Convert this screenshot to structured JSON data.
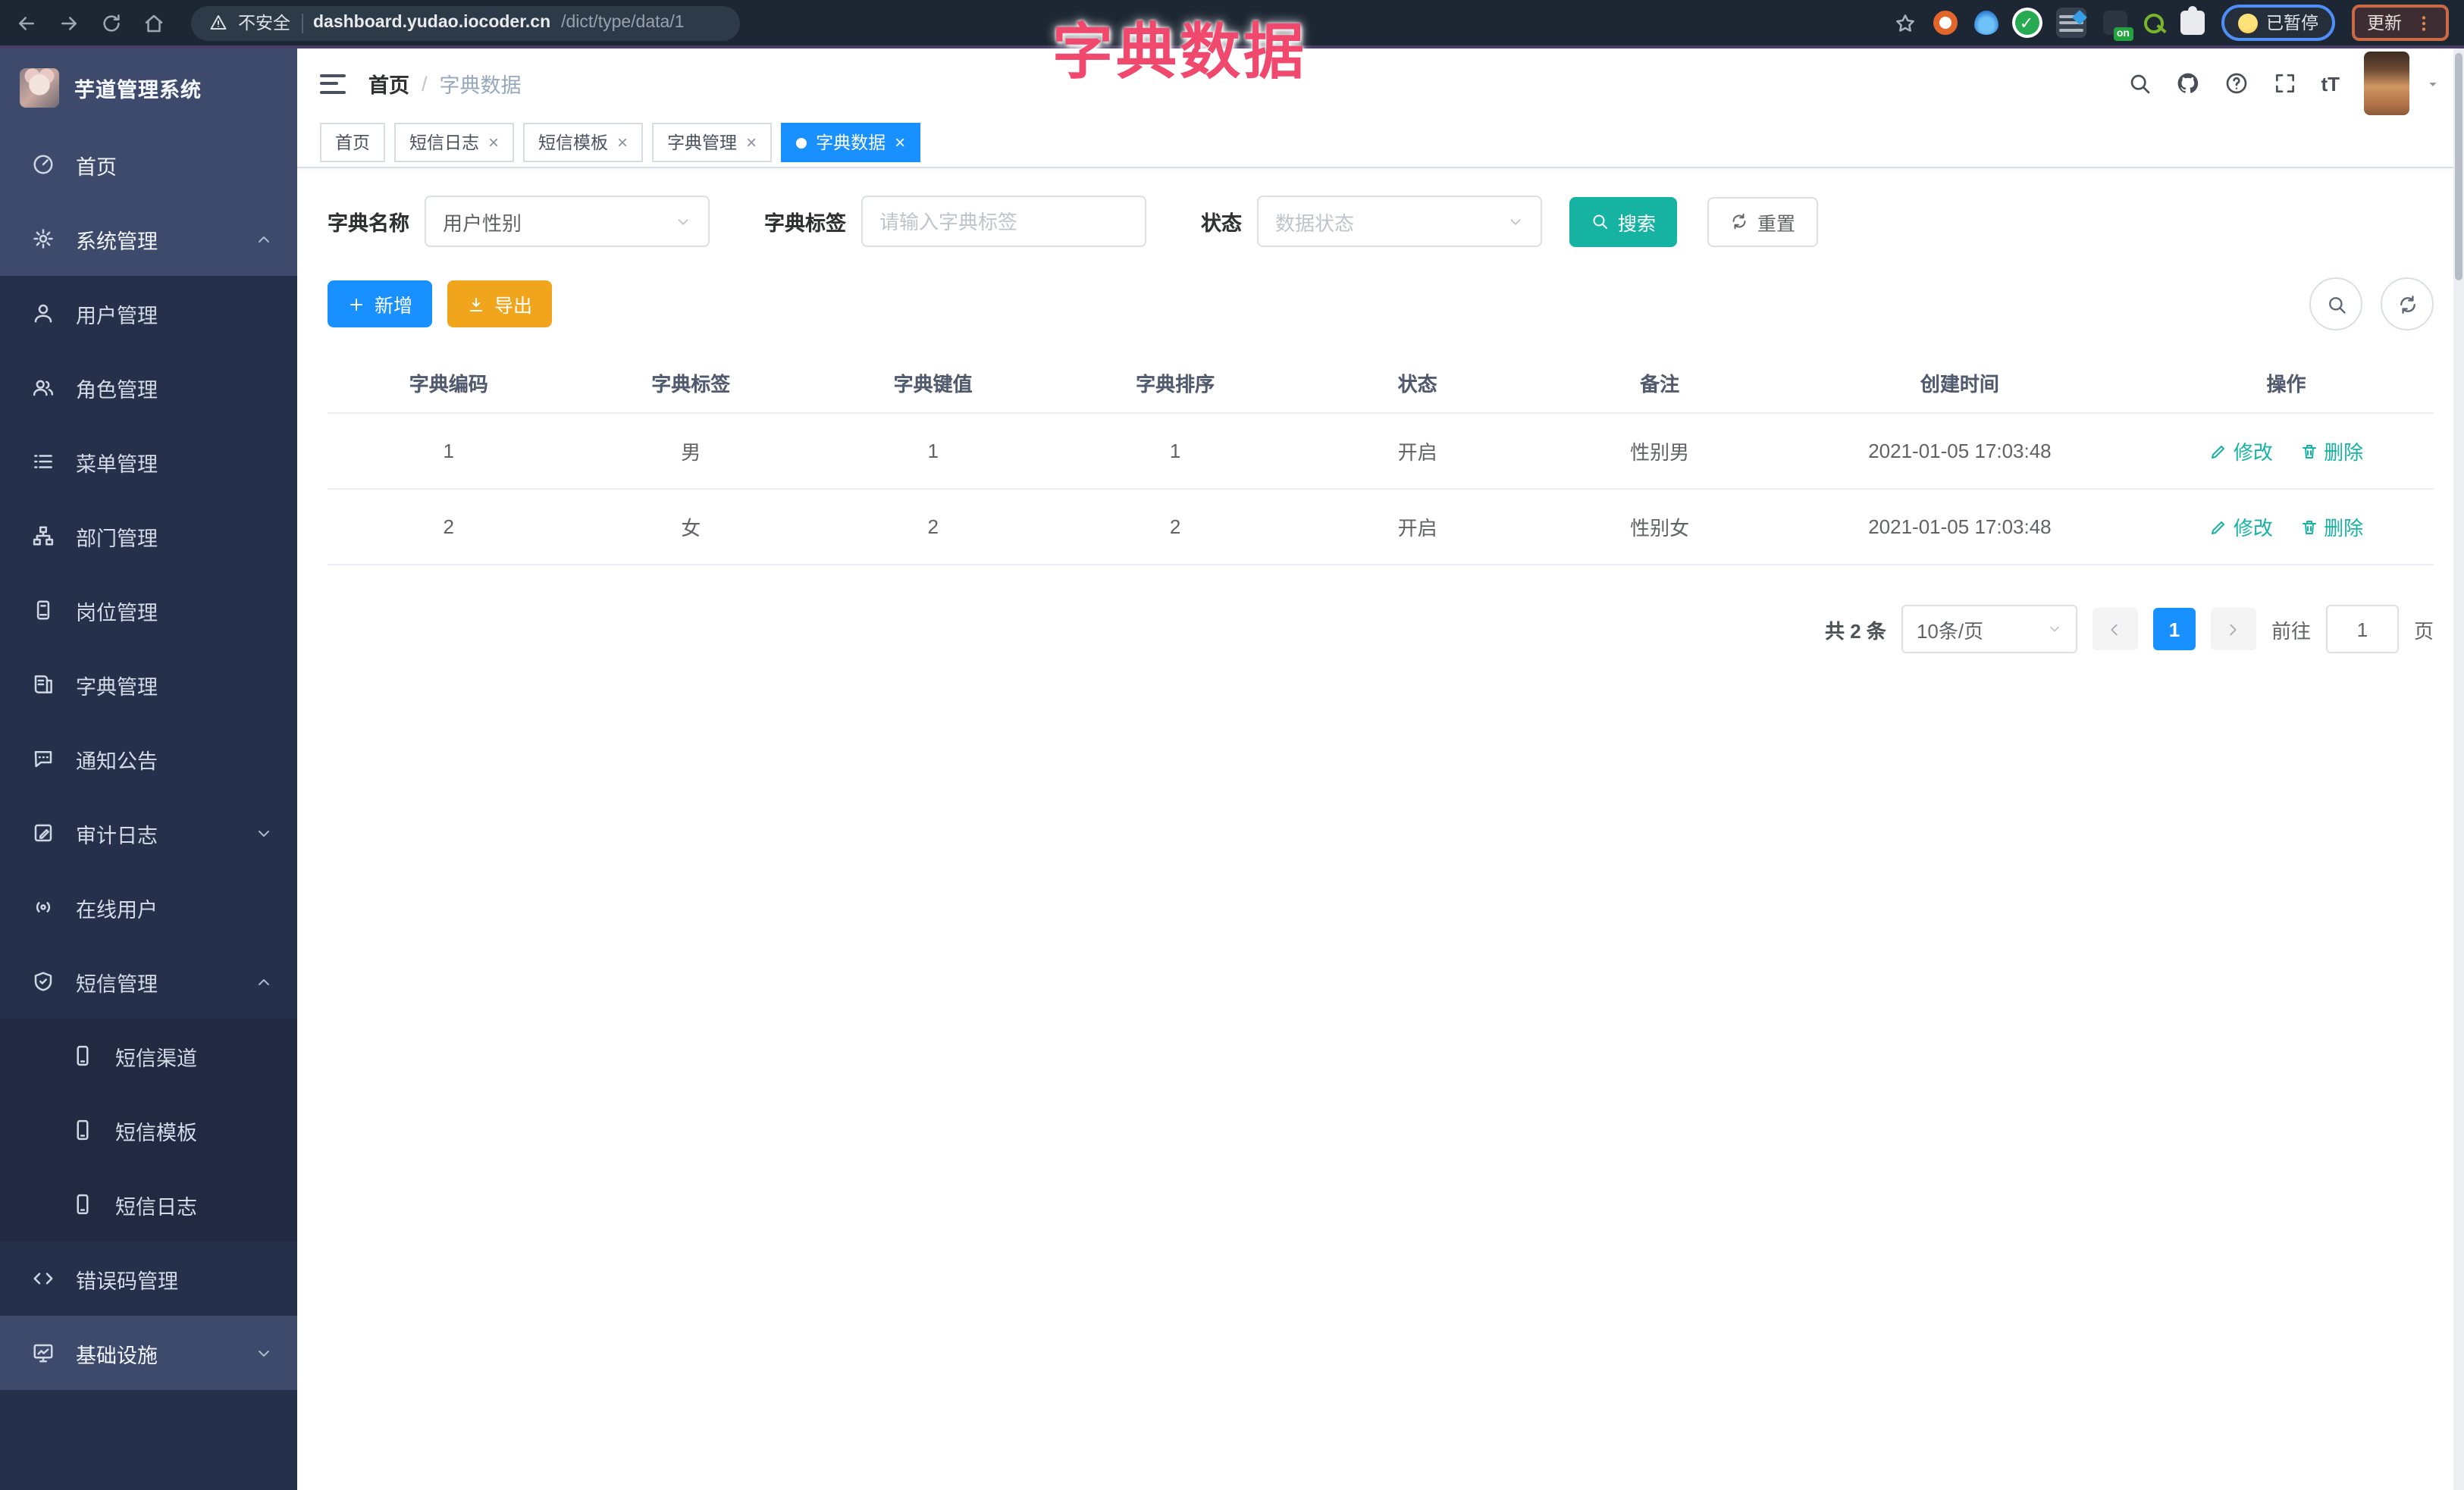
{
  "browser": {
    "security_label": "不安全",
    "url_domain": "dashboard.yudao.iocoder.cn",
    "url_path": "/dict/type/data/1",
    "paused_label": "已暂停",
    "update_label": "更新",
    "on_badge": "on"
  },
  "annotation": {
    "title": "字典数据",
    "color": "#f1486d"
  },
  "sidebar": {
    "logo_title": "芋道管理系统",
    "items": [
      {
        "label": "首页"
      },
      {
        "label": "系统管理"
      },
      {
        "label": "用户管理"
      },
      {
        "label": "角色管理"
      },
      {
        "label": "菜单管理"
      },
      {
        "label": "部门管理"
      },
      {
        "label": "岗位管理"
      },
      {
        "label": "字典管理"
      },
      {
        "label": "通知公告"
      },
      {
        "label": "审计日志"
      },
      {
        "label": "在线用户"
      },
      {
        "label": "短信管理"
      },
      {
        "label": "短信渠道"
      },
      {
        "label": "短信模板"
      },
      {
        "label": "短信日志"
      },
      {
        "label": "错误码管理"
      },
      {
        "label": "基础设施"
      }
    ]
  },
  "topbar": {
    "breadcrumb_home": "首页",
    "breadcrumb_sep": "/",
    "breadcrumb_current": "字典数据",
    "fontsize_label": "tT"
  },
  "tabs": [
    {
      "label": "首页"
    },
    {
      "label": "短信日志"
    },
    {
      "label": "短信模板"
    },
    {
      "label": "字典管理"
    },
    {
      "label": "字典数据"
    }
  ],
  "filter": {
    "name_label": "字典名称",
    "name_value": "用户性别",
    "tag_label": "字典标签",
    "tag_placeholder": "请输入字典标签",
    "status_label": "状态",
    "status_placeholder": "数据状态",
    "search_label": "搜索",
    "reset_label": "重置"
  },
  "toolbar": {
    "add_label": "新增",
    "export_label": "导出"
  },
  "table": {
    "headers": [
      "字典编码",
      "字典标签",
      "字典键值",
      "字典排序",
      "状态",
      "备注",
      "创建时间",
      "操作"
    ],
    "rows": [
      {
        "code": "1",
        "label": "男",
        "value": "1",
        "sort": "1",
        "status": "开启",
        "remark": "性别男",
        "created": "2021-01-05 17:03:48"
      },
      {
        "code": "2",
        "label": "女",
        "value": "2",
        "sort": "2",
        "status": "开启",
        "remark": "性别女",
        "created": "2021-01-05 17:03:48"
      }
    ],
    "edit_label": "修改",
    "delete_label": "删除"
  },
  "pagination": {
    "total": "共 2 条",
    "page_size": "10条/页",
    "page": "1",
    "goto_label": "前往",
    "goto_value": "1",
    "unit_label": "页"
  },
  "colors": {
    "primary_blue": "#1890ff",
    "teal": "#16b3a3",
    "warning_orange": "#f0a51c",
    "sidebar_dark": "#26304a",
    "sidebar_light": "#3d4a6c"
  }
}
